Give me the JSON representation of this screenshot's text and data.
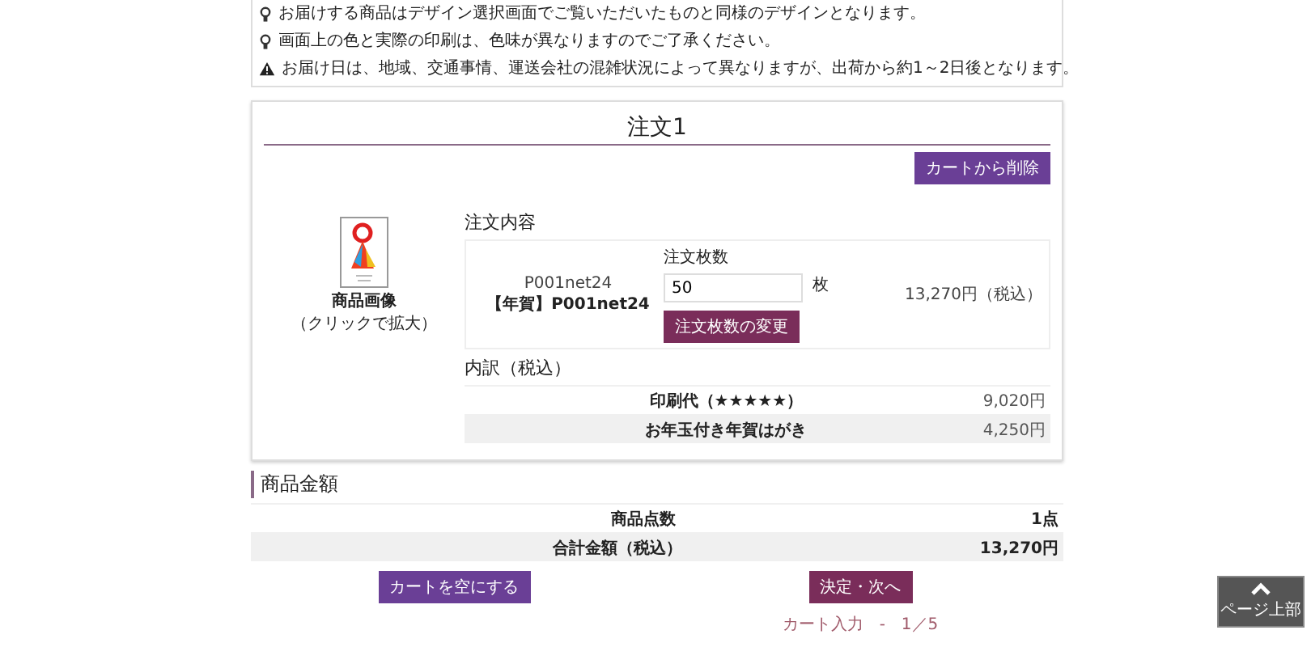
{
  "notices": [
    {
      "kind": "tip",
      "text": "お届けする商品はデザイン選択画面でご覧いただいたものと同様のデザインとなります。"
    },
    {
      "kind": "tip",
      "text": "画面上の色と実際の印刷は、色味が異なりますのでご了承ください。"
    },
    {
      "kind": "warning",
      "text": "お届け日は、地域、交通事情、運送会社の混雑状況によって異なりますが、出荷から約1～2日後となります。"
    }
  ],
  "order": {
    "title": "注文1",
    "delete_button": "カートから削除",
    "image_caption": "商品画像",
    "image_hint": "（クリックで拡大）",
    "content_heading": "注文内容",
    "item": {
      "code": "P001net24",
      "name": "【年賀】P001net24",
      "quantity_label": "注文枚数",
      "quantity": "50",
      "unit": "枚",
      "update_button": "注文枚数の変更",
      "price": "13,270円（税込）"
    },
    "breakdown_heading": "内訳（税込）",
    "breakdown": [
      {
        "label": "印刷代（★★★★★）",
        "amount": "9,020円"
      },
      {
        "label": "お年玉付き年賀はがき",
        "amount": "4,250円"
      }
    ]
  },
  "summary": {
    "heading": "商品金額",
    "rows": [
      {
        "label": "商品点数",
        "value": "1点"
      },
      {
        "label": "合計金額（税込）",
        "value": "13,270円"
      }
    ]
  },
  "buttons": {
    "empty_cart": "カートを空にする",
    "next": "決定・次へ"
  },
  "progress": "カート入力　-　1／5",
  "back_to_top": "ページ上部"
}
